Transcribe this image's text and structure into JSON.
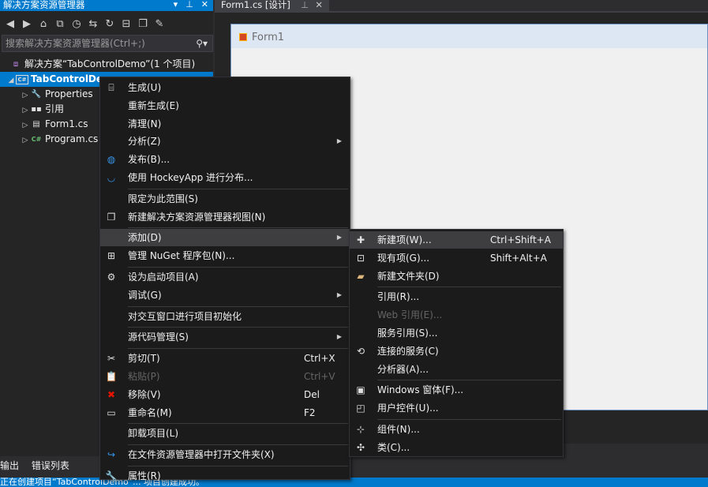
{
  "solution_explorer": {
    "title": "解决方案资源管理器",
    "title_controls": [
      "▾",
      "⊥",
      "✕"
    ],
    "toolbar_icons": [
      "back-icon",
      "forward-icon",
      "home-icon",
      "switch-view-icon",
      "history-icon",
      "sync-icon",
      "refresh-icon",
      "collapse-icon",
      "copy-icon",
      "wrench-icon"
    ],
    "search_placeholder": "搜索解决方案资源管理器(Ctrl+;)",
    "tree": [
      {
        "label": "解决方案“TabControlDemo”(1 个项目)",
        "icon": "solution-icon",
        "indent": 0,
        "expander": ""
      },
      {
        "label": "TabControlDemo",
        "icon": "csharp-project-icon",
        "indent": 0,
        "expander": "◢",
        "selected": true
      },
      {
        "label": "Properties",
        "icon": "wrench-icon",
        "indent": 1,
        "expander": "▷"
      },
      {
        "label": "引用",
        "icon": "reference-icon",
        "indent": 1,
        "expander": "▷"
      },
      {
        "label": "Form1.cs",
        "icon": "form-icon",
        "indent": 1,
        "expander": "▷"
      },
      {
        "label": "Program.cs",
        "icon": "csharp-file-icon",
        "indent": 1,
        "expander": "▷"
      }
    ]
  },
  "document_tab": {
    "label": "Form1.cs [设计]",
    "pin": "⊥",
    "close": "✕"
  },
  "form": {
    "title": "Form1"
  },
  "bottom_tabs": [
    "输出",
    "错误列表"
  ],
  "status_text": "正在创建项目“TabControlDemo”... 项目创建成功。",
  "context_menu": [
    {
      "label": "生成(U)",
      "icon": "build-icon"
    },
    {
      "label": "重新生成(E)"
    },
    {
      "label": "清理(N)"
    },
    {
      "label": "分析(Z)",
      "submenu": true
    },
    {
      "label": "发布(B)...",
      "icon": "publish-icon"
    },
    {
      "label": "使用 HockeyApp 进行分布...",
      "icon": "hockeyapp-icon"
    },
    {
      "sep": true
    },
    {
      "label": "限定为此范围(S)"
    },
    {
      "label": "新建解决方案资源管理器视图(N)",
      "icon": "new-view-icon"
    },
    {
      "sep": true
    },
    {
      "label": "添加(D)",
      "submenu": true,
      "highlighted": true
    },
    {
      "label": "管理 NuGet 程序包(N)...",
      "icon": "nuget-icon"
    },
    {
      "sep": true
    },
    {
      "label": "设为启动项目(A)",
      "icon": "gear-icon"
    },
    {
      "label": "调试(G)",
      "submenu": true
    },
    {
      "sep": true
    },
    {
      "label": "对交互窗口进行项目初始化"
    },
    {
      "sep": true
    },
    {
      "label": "源代码管理(S)",
      "submenu": true
    },
    {
      "sep": true
    },
    {
      "label": "剪切(T)",
      "icon": "scissors-icon",
      "shortcut": "Ctrl+X"
    },
    {
      "label": "粘贴(P)",
      "icon": "paste-icon",
      "shortcut": "Ctrl+V",
      "disabled": true
    },
    {
      "label": "移除(V)",
      "icon": "remove-icon",
      "shortcut": "Del"
    },
    {
      "label": "重命名(M)",
      "icon": "rename-icon",
      "shortcut": "F2"
    },
    {
      "sep": true
    },
    {
      "label": "卸载项目(L)"
    },
    {
      "sep": true
    },
    {
      "label": "在文件资源管理器中打开文件夹(X)",
      "icon": "open-folder-icon"
    },
    {
      "sep": true
    },
    {
      "label": "属性(R)",
      "icon": "wrench-icon"
    }
  ],
  "submenu": [
    {
      "label": "新建项(W)...",
      "icon": "new-item-icon",
      "shortcut": "Ctrl+Shift+A",
      "highlighted": true
    },
    {
      "label": "现有项(G)...",
      "icon": "existing-item-icon",
      "shortcut": "Shift+Alt+A"
    },
    {
      "label": "新建文件夹(D)",
      "icon": "new-folder-icon"
    },
    {
      "sep": true
    },
    {
      "label": "引用(R)..."
    },
    {
      "label": "Web 引用(E)...",
      "disabled": true
    },
    {
      "label": "服务引用(S)..."
    },
    {
      "label": "连接的服务(C)",
      "icon": "connected-service-icon"
    },
    {
      "label": "分析器(A)..."
    },
    {
      "sep": true
    },
    {
      "label": "Windows 窗体(F)...",
      "icon": "windows-form-icon"
    },
    {
      "label": "用户控件(U)...",
      "icon": "user-control-icon"
    },
    {
      "sep": true
    },
    {
      "label": "组件(N)...",
      "icon": "component-icon"
    },
    {
      "label": "类(C)...",
      "icon": "class-icon"
    }
  ]
}
